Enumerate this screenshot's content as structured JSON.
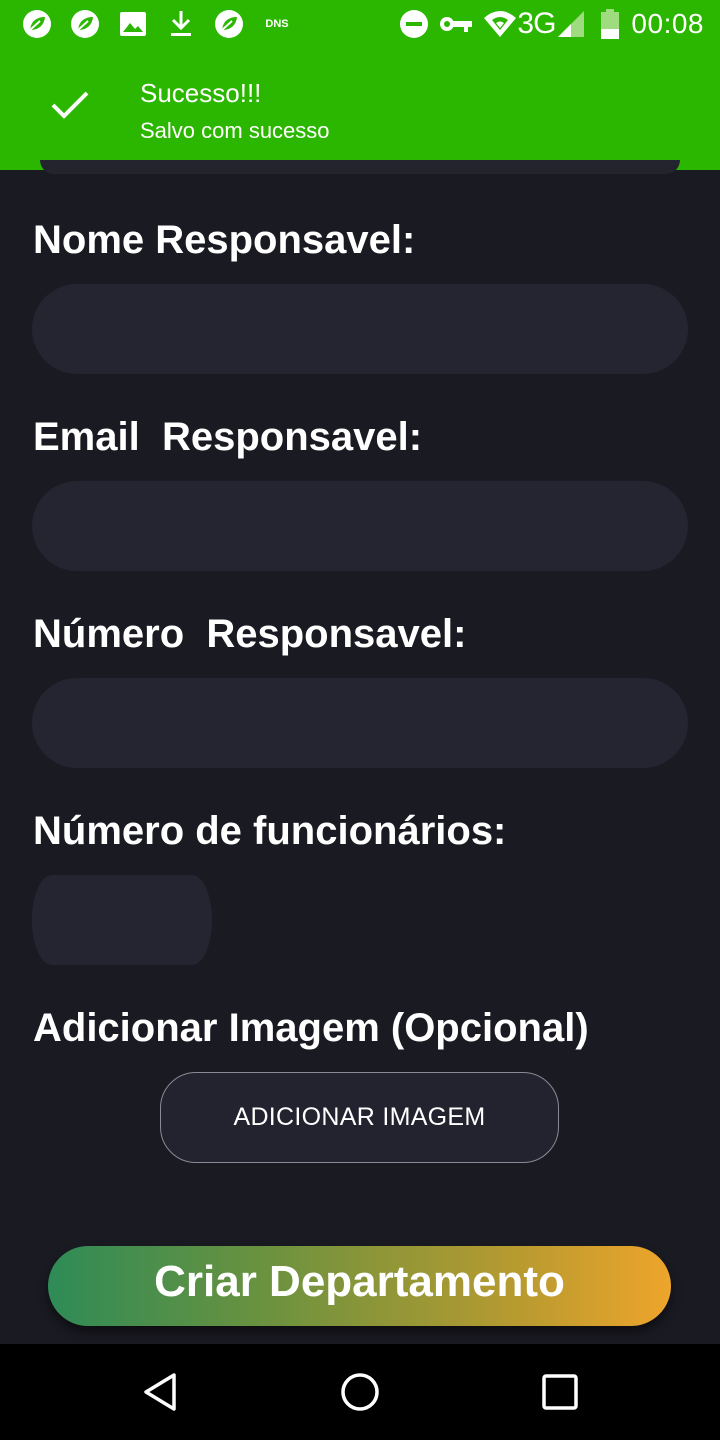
{
  "status_bar": {
    "left_icons": [
      "leaf-icon",
      "leaf-icon",
      "image-icon",
      "download-icon",
      "leaf-icon",
      "dns-icon"
    ],
    "dns_label": "DNS",
    "right_icons": [
      "do-not-disturb-icon",
      "vpn-key-icon",
      "wifi-icon",
      "signal-icon",
      "battery-icon"
    ],
    "network": "3G",
    "time": "00:08"
  },
  "toast": {
    "title": "Sucesso!!!",
    "message": "Salvo com sucesso",
    "icon": "check-icon"
  },
  "form": {
    "nome_label": "Nome Responsavel:",
    "nome_value": "",
    "email_label": "Email  Responsavel:",
    "email_value": "",
    "numero_label": "Número  Responsavel:",
    "numero_value": "",
    "funcionarios_label": "Número de funcionários:",
    "funcionarios_value": "",
    "imagem_label": "Adicionar Imagem (Opcional)",
    "add_image_button": "ADICIONAR IMAGEM",
    "submit_button": "Criar Departamento"
  },
  "nav_bar": {
    "buttons": [
      "back-icon",
      "home-icon",
      "recents-icon"
    ]
  },
  "colors": {
    "accent_green": "#2bb700",
    "background": "#1a1a22",
    "field_bg": "#252532",
    "gradient_start": "#2e8b57",
    "gradient_end": "#eea52b"
  }
}
